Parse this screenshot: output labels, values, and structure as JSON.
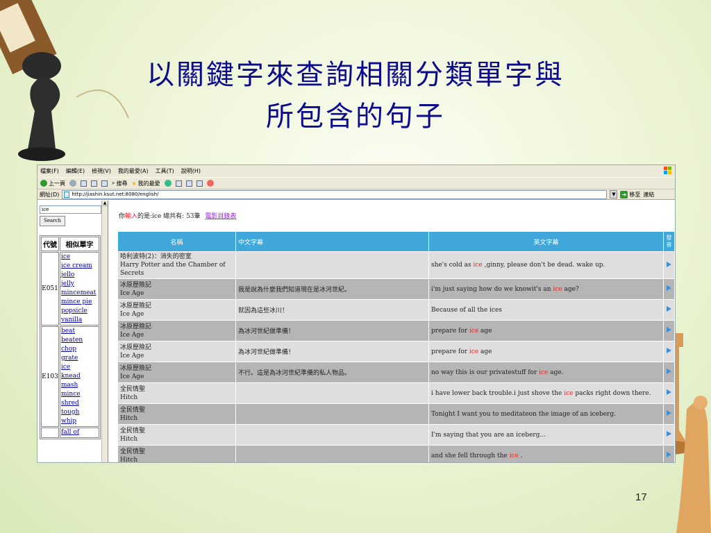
{
  "slide": {
    "title_line1": "以關鍵字來查詢相關分類單字與",
    "title_line2": "所包含的句子",
    "page_number": "17"
  },
  "browser": {
    "menu": [
      "檔案(F)",
      "編輯(E)",
      "檢視(V)",
      "我的最愛(A)",
      "工具(T)",
      "說明(H)"
    ],
    "toolbar": {
      "back": "上一頁",
      "search": "搜尋",
      "favorites": "我的最愛"
    },
    "address": {
      "label": "網址(D)",
      "url": "http://jiashin.ksut.net:8080/english/",
      "go_label": "移至",
      "links_label": "連結"
    }
  },
  "left_frame": {
    "search_value": "ice",
    "search_button": "Search",
    "col_code": "代號",
    "col_words": "相似單字",
    "groups": [
      {
        "code": "E051",
        "words": [
          "ice",
          "ice cream",
          "jello",
          "jelly",
          "mincemeat",
          "mince pie",
          "popsicle",
          "vanilla"
        ]
      },
      {
        "code": "E103",
        "words": [
          "beat",
          "beaten",
          "chop",
          "grate",
          "ice",
          "knead",
          "mash",
          "mince",
          "shred",
          "tough",
          "whip"
        ]
      },
      {
        "code": "",
        "words": [
          "fall of"
        ]
      }
    ]
  },
  "results": {
    "prefix": "你",
    "input_hl": "輸入",
    "middle": "的是:ice  總共有: 53筆",
    "link": "電影目錄表",
    "headers": {
      "name": "名稱",
      "cn": "中文字幕",
      "en": "英文字幕",
      "audio": "發音"
    },
    "rows": [
      {
        "title_zh": "哈利波特(2)：消失的密室",
        "title_en": "Harry Potter and the Chamber of Secrets",
        "cn": "",
        "en_pre": "she's cold as ",
        "en_hl": "ice",
        "en_post": " ,ginny, please don't be dead. wake up."
      },
      {
        "title_zh": "冰原歷險記",
        "title_en": "Ice Age",
        "cn": "我是說為什麼我們知道現在是冰河世紀。",
        "en_pre": "i'm just saying how do we knowit's an ",
        "en_hl": "ice",
        "en_post": " age?"
      },
      {
        "title_zh": "冰原歷險記",
        "title_en": "Ice Age",
        "cn": "就因為這些冰川！",
        "en_pre": "Because of all the ices",
        "en_hl": "",
        "en_post": ""
      },
      {
        "title_zh": "冰原歷險記",
        "title_en": "Ice Age",
        "cn": "為冰河世紀做準備！",
        "en_pre": "prepare for ",
        "en_hl": "ice",
        "en_post": " age"
      },
      {
        "title_zh": "冰原歷險記",
        "title_en": "Ice Age",
        "cn": "為冰河世紀做準備！",
        "en_pre": "prepare for ",
        "en_hl": "ice",
        "en_post": " age"
      },
      {
        "title_zh": "冰原歷險記",
        "title_en": "Ice Age",
        "cn": "不行。這是為冰河世紀準備的私人物品。",
        "en_pre": "no way this is our privatestuff for ",
        "en_hl": "ice",
        "en_post": " age."
      },
      {
        "title_zh": "全民情聖",
        "title_en": "Hitch",
        "cn": "",
        "en_pre": "i have lower back trouble.i just shove the ",
        "en_hl": "ice",
        "en_post": " packs right down there."
      },
      {
        "title_zh": "全民情聖",
        "title_en": "Hitch",
        "cn": "",
        "en_pre": "Tonight I want you to meditateon the image of an iceberg.",
        "en_hl": "",
        "en_post": ""
      },
      {
        "title_zh": "全民情聖",
        "title_en": "Hitch",
        "cn": "",
        "en_pre": "I'm saying that you are an iceberg...",
        "en_hl": "",
        "en_post": ""
      },
      {
        "title_zh": "全民情聖",
        "title_en": "Hitch",
        "cn": "",
        "en_pre": "and she fell through the ",
        "en_hl": "ice",
        "en_post": " ."
      }
    ]
  }
}
